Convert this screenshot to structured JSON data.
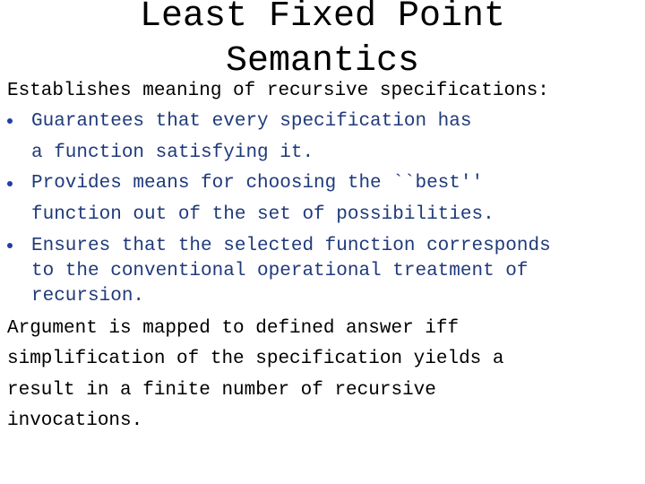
{
  "slide": {
    "title_line1": "Least Fixed Point",
    "title_line2": "Semantics",
    "intro": "Establishes meaning of recursive specifications:",
    "bullets": [
      {
        "lines": [
          "Guarantees that every specification has",
          "a function satisfying it."
        ]
      },
      {
        "lines": [
          "Provides means for choosing the ``best''",
          "function out of the set of possibilities."
        ]
      },
      {
        "lines": [
          "Ensures that the selected function corresponds",
          "to the conventional operational treatment of",
          "recursion."
        ]
      }
    ],
    "conclusion": [
      "Argument is mapped to defined answer iff",
      "simplification of the specification yields a",
      "result in a finite number of recursive",
      "invocations."
    ],
    "colors": {
      "text": "#000000",
      "bullet_text": "#1f3a7a",
      "bullet_dot": "#1f3fa8",
      "background": "#ffffff"
    }
  }
}
